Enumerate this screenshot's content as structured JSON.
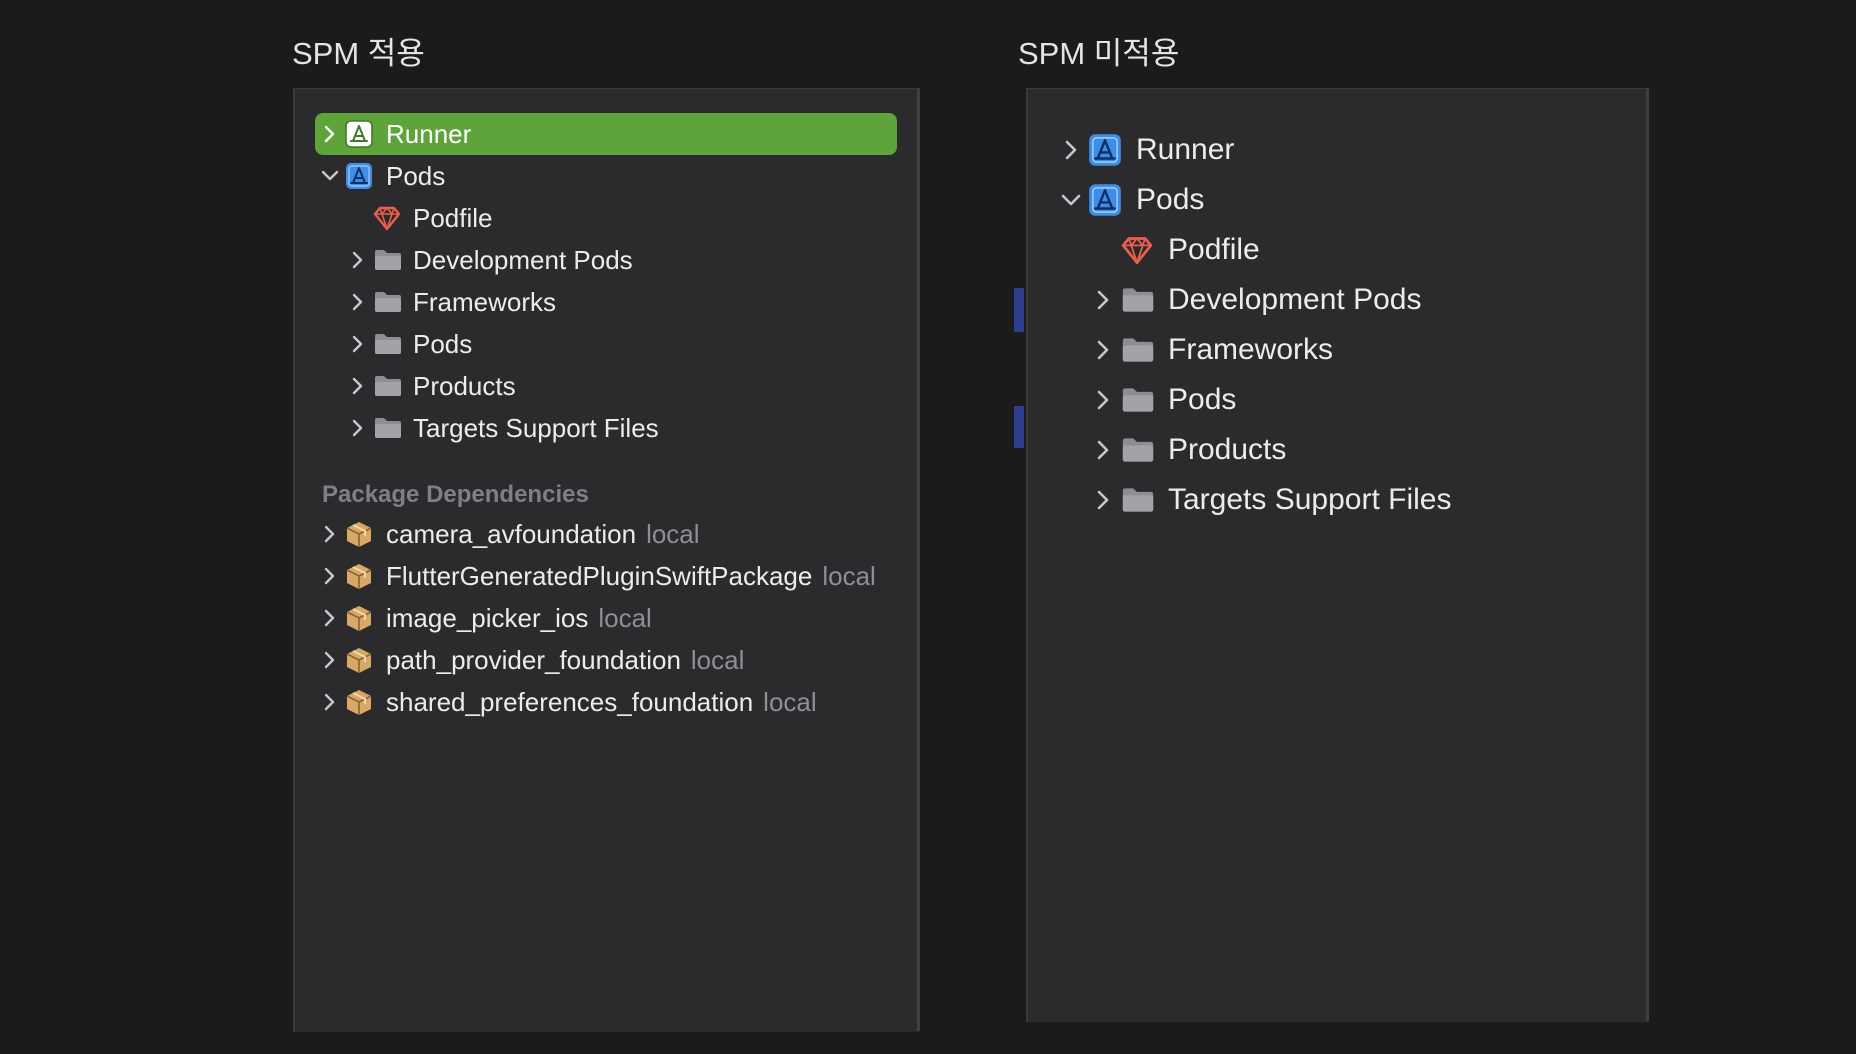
{
  "captions": {
    "left": "SPM 적용",
    "right": "SPM 미적용"
  },
  "left_panel": {
    "selected_item": "Runner",
    "tree": [
      {
        "label": "Runner",
        "icon": "xcode-project-icon",
        "expanded": false,
        "selected": true
      },
      {
        "label": "Pods",
        "icon": "xcode-project-icon",
        "expanded": true
      },
      {
        "label": "Podfile",
        "icon": "ruby-gem-icon"
      },
      {
        "label": "Development Pods",
        "icon": "folder-icon",
        "expanded": false
      },
      {
        "label": "Frameworks",
        "icon": "folder-icon",
        "expanded": false
      },
      {
        "label": "Pods",
        "icon": "folder-icon",
        "expanded": false
      },
      {
        "label": "Products",
        "icon": "folder-icon",
        "expanded": false
      },
      {
        "label": "Targets Support Files",
        "icon": "folder-icon",
        "expanded": false
      }
    ],
    "section_title": "Package Dependencies",
    "packages": [
      {
        "name": "camera_avfoundation",
        "tag": "local",
        "icon": "package-icon"
      },
      {
        "name": "FlutterGeneratedPluginSwiftPackage",
        "tag": "local",
        "icon": "package-icon"
      },
      {
        "name": "image_picker_ios",
        "tag": "local",
        "icon": "package-icon"
      },
      {
        "name": "path_provider_foundation",
        "tag": "local",
        "icon": "package-icon"
      },
      {
        "name": "shared_preferences_foundation",
        "tag": "local",
        "icon": "package-icon"
      }
    ]
  },
  "right_panel": {
    "tree": [
      {
        "label": "Runner",
        "icon": "xcode-project-icon",
        "expanded": false
      },
      {
        "label": "Pods",
        "icon": "xcode-project-icon",
        "expanded": true
      },
      {
        "label": "Podfile",
        "icon": "ruby-gem-icon"
      },
      {
        "label": "Development Pods",
        "icon": "folder-icon",
        "expanded": false
      },
      {
        "label": "Frameworks",
        "icon": "folder-icon",
        "expanded": false
      },
      {
        "label": "Pods",
        "icon": "folder-icon",
        "expanded": false
      },
      {
        "label": "Products",
        "icon": "folder-icon",
        "expanded": false
      },
      {
        "label": "Targets Support Files",
        "icon": "folder-icon",
        "expanded": false
      }
    ]
  },
  "colors": {
    "background": "#1b1b1d",
    "panel": "#2b2b2e",
    "selection": "#5fa43b",
    "project_icon": "#3d8ee8",
    "gem": "#e8604c",
    "package": "#d7a866",
    "folder": "#8d8d92",
    "muted_text": "#8e8e93"
  }
}
